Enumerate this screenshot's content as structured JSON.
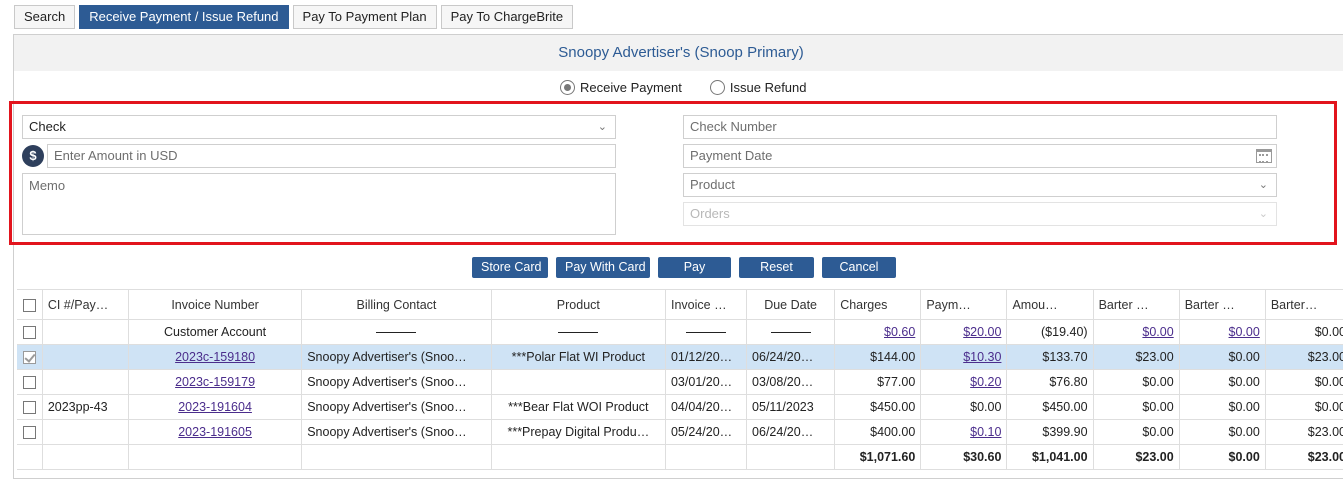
{
  "tabs": [
    "Search",
    "Receive Payment / Issue Refund",
    "Pay To Payment Plan",
    "Pay To ChargeBrite"
  ],
  "header": {
    "title": "Snoopy Advertiser's (Snoop Primary)"
  },
  "mode": {
    "receive_label": "Receive Payment",
    "refund_label": "Issue Refund",
    "selected": "Receive Payment"
  },
  "form": {
    "payment_type": "Check",
    "amount_placeholder": "Enter Amount in USD",
    "currency_symbol": "$",
    "memo_placeholder": "Memo",
    "check_number_placeholder": "Check Number",
    "payment_date_placeholder": "Payment Date",
    "product_placeholder": "Product",
    "orders_placeholder": "Orders"
  },
  "actions": {
    "store_card": "Store Card",
    "pay_with_card": "Pay With Card",
    "pay": "Pay",
    "reset": "Reset",
    "cancel": "Cancel"
  },
  "table": {
    "headers": [
      "CI #/Pay…",
      "Invoice Number",
      "Billing Contact",
      "Product",
      "Invoice …",
      "Due Date",
      "Charges",
      "Paym…",
      "Amou…",
      "Barter …",
      "Barter …",
      "Barter…"
    ],
    "customer_row": {
      "label": "Customer Account",
      "charges": "$0.60",
      "payments": "$20.00",
      "amount": "($19.40)",
      "barter1": "$0.00",
      "barter2": "$0.00",
      "barter3": "$0.00"
    },
    "rows": [
      {
        "ci": "",
        "invoice": "2023c-159180",
        "contact": "Snoopy Advertiser's (Snoo…",
        "product": "***Polar Flat WI Product",
        "invoice_date": "01/12/20…",
        "due_date": "06/24/20…",
        "charges": "$144.00",
        "payments": "$10.30",
        "amount": "$133.70",
        "barter1": "$23.00",
        "barter2": "$0.00",
        "barter3": "$23.00",
        "checked": true,
        "payments_link": true
      },
      {
        "ci": "",
        "invoice": "2023c-159179",
        "contact": "Snoopy Advertiser's (Snoo…",
        "product": "",
        "invoice_date": "03/01/20…",
        "due_date": "03/08/20…",
        "charges": "$77.00",
        "payments": "$0.20",
        "amount": "$76.80",
        "barter1": "$0.00",
        "barter2": "$0.00",
        "barter3": "$0.00",
        "checked": false,
        "payments_link": true
      },
      {
        "ci": "2023pp-43",
        "invoice": "2023-191604",
        "contact": "Snoopy Advertiser's (Snoo…",
        "product": "***Bear Flat WOI Product",
        "invoice_date": "04/04/20…",
        "due_date": "05/11/2023",
        "charges": "$450.00",
        "payments": "$0.00",
        "amount": "$450.00",
        "barter1": "$0.00",
        "barter2": "$0.00",
        "barter3": "$0.00",
        "checked": false,
        "payments_link": false
      },
      {
        "ci": "",
        "invoice": "2023-191605",
        "contact": "Snoopy Advertiser's (Snoo…",
        "product": "***Prepay Digital Produ…",
        "invoice_date": "05/24/20…",
        "due_date": "06/24/20…",
        "charges": "$400.00",
        "payments": "$0.10",
        "amount": "$399.90",
        "barter1": "$0.00",
        "barter2": "$0.00",
        "barter3": "$23.00",
        "checked": false,
        "payments_link": true
      }
    ],
    "totals": {
      "charges": "$1,071.60",
      "payments": "$30.60",
      "amount": "$1,041.00",
      "barter1": "$23.00",
      "barter2": "$0.00",
      "barter3": "$23.00"
    }
  },
  "colors": {
    "accent": "#2d5b94",
    "highlight_box": "#e2141d",
    "selected_row": "#cfe3f5",
    "link": "#4b2d8c"
  }
}
